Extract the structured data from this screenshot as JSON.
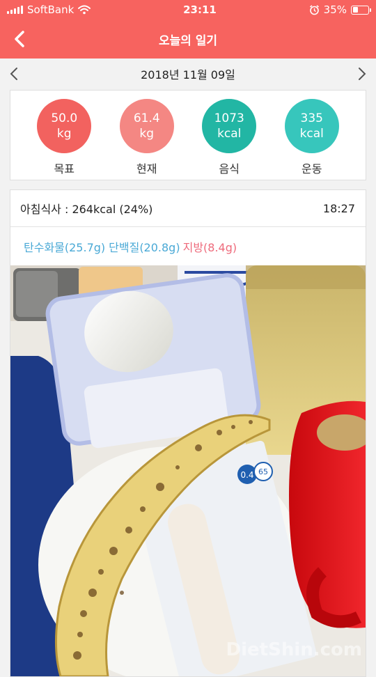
{
  "status_bar": {
    "carrier": "SoftBank",
    "time": "23:11",
    "battery": "35%",
    "battery_level": 0.35
  },
  "nav": {
    "title": "오늘의 일기"
  },
  "date_nav": {
    "date": "2018년 11월 09일"
  },
  "stats": [
    {
      "value": "50.0",
      "unit": "kg",
      "label": "목표",
      "color": "#f2625f"
    },
    {
      "value": "61.4",
      "unit": "kg",
      "label": "현재",
      "color": "#f48783"
    },
    {
      "value": "1073",
      "unit": "kcal",
      "label": "음식",
      "color": "#22b6a4"
    },
    {
      "value": "335",
      "unit": "kcal",
      "label": "운동",
      "color": "#37c6bc"
    }
  ],
  "meal": {
    "title": "아침식사 : 264kcal (24%)",
    "time": "18:27",
    "carb": "탄수화물(25.7g)",
    "protein": "단백질(20.8g)",
    "fat": "지방(8.4g)"
  },
  "photo": {
    "package_values": [
      "0.4",
      "65"
    ],
    "watermark": "DietShin.com"
  }
}
